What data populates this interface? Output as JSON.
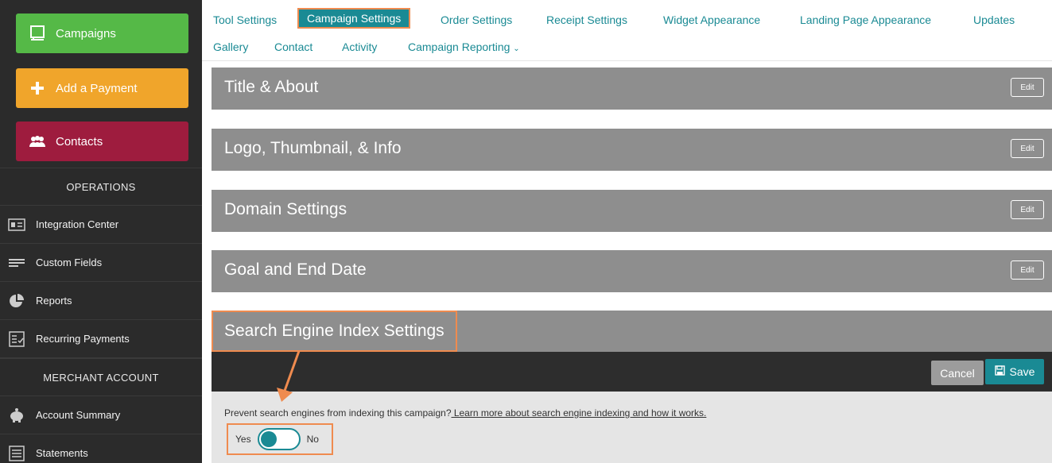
{
  "sidebar": {
    "campaigns_label": "Campaigns",
    "add_payment_label": "Add a Payment",
    "contacts_label": "Contacts",
    "operations_heading": "OPERATIONS",
    "merchant_heading": "MERCHANT ACCOUNT",
    "items": [
      {
        "label": "Integration Center",
        "icon": "id-card-icon"
      },
      {
        "label": "Custom Fields",
        "icon": "lines-icon"
      },
      {
        "label": "Reports",
        "icon": "pie-chart-icon"
      },
      {
        "label": "Recurring Payments",
        "icon": "checklist-icon"
      },
      {
        "label": "Account Summary",
        "icon": "piggy-bank-icon"
      },
      {
        "label": "Statements",
        "icon": "list-icon"
      }
    ]
  },
  "tabs": [
    {
      "label": "Tool Settings"
    },
    {
      "label": "Campaign Settings"
    },
    {
      "label": "Order Settings"
    },
    {
      "label": "Receipt Settings"
    },
    {
      "label": "Widget Appearance"
    },
    {
      "label": "Landing Page Appearance"
    },
    {
      "label": "Updates"
    },
    {
      "label": "Gallery"
    },
    {
      "label": "Contact"
    },
    {
      "label": "Activity"
    },
    {
      "label": "Campaign Reporting"
    }
  ],
  "panels": [
    {
      "title": "Title & About",
      "edit": "Edit"
    },
    {
      "title": "Logo, Thumbnail, & Info",
      "edit": "Edit"
    },
    {
      "title": "Domain Settings",
      "edit": "Edit"
    },
    {
      "title": "Goal and End Date",
      "edit": "Edit"
    }
  ],
  "search_index": {
    "title": "Search Engine Index Settings",
    "cancel_label": "Cancel",
    "save_label": "Save",
    "question": "Prevent search engines from indexing this campaign?",
    "learn_more": " Learn more about search engine indexing and how it works.",
    "yes_label": "Yes",
    "no_label": "No",
    "toggle_value": "Yes"
  },
  "colors": {
    "accent": "#1a8a94",
    "highlight": "#ef8b4f",
    "campaigns": "#55b947",
    "payment": "#f0a52b",
    "contacts": "#9e1c3e"
  }
}
